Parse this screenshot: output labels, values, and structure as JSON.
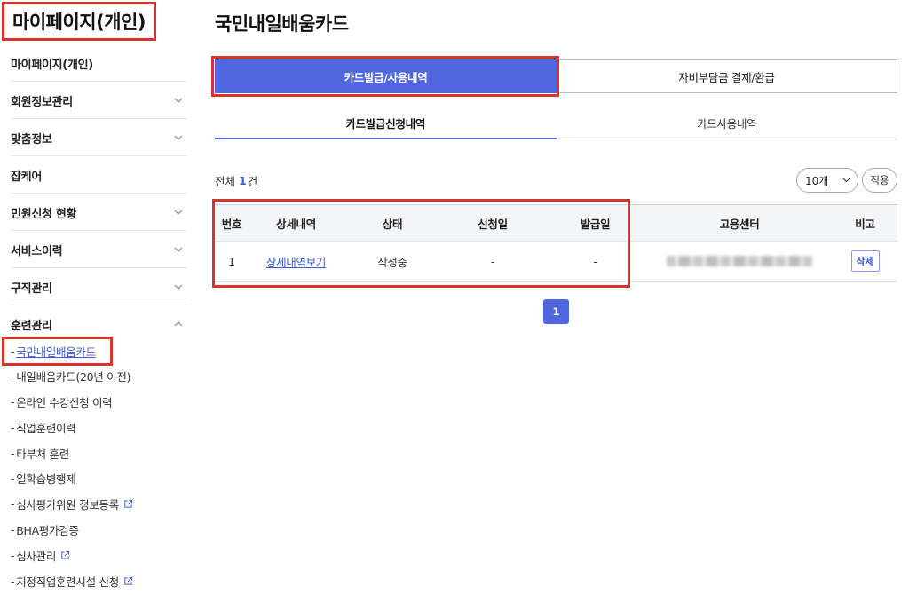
{
  "sidebar": {
    "title": "마이페이지(개인)",
    "menu": [
      {
        "label": "마이페이지(개인)"
      },
      {
        "label": "회원정보관리"
      },
      {
        "label": "맞춤정보"
      },
      {
        "label": "잡케어"
      },
      {
        "label": "민원신청 현황"
      },
      {
        "label": "서비스이력"
      },
      {
        "label": "구직관리"
      },
      {
        "label": "훈련관리"
      }
    ],
    "sub_items": [
      {
        "label": "국민내일배움카드"
      },
      {
        "label": "내일배움카드(20년 이전)"
      },
      {
        "label": "온라인 수강신청 이력"
      },
      {
        "label": "직업훈련이력"
      },
      {
        "label": "타부처 훈련"
      },
      {
        "label": "일학습병행제"
      },
      {
        "label": "심사평가위원 정보등록"
      },
      {
        "label": "BHA평가검증"
      },
      {
        "label": "심사관리"
      },
      {
        "label": "지정직업훈련시설 신청"
      }
    ],
    "dash": "-"
  },
  "main": {
    "title": "국민내일배움카드",
    "tabs": [
      {
        "label": "카드발급/사용내역"
      },
      {
        "label": "자비부담금 결제/환급"
      }
    ],
    "subtabs": [
      {
        "label": "카드발급신청내역"
      },
      {
        "label": "카드사용내역"
      }
    ],
    "total": {
      "prefix": "전체",
      "count": "1",
      "suffix": "건"
    },
    "page_size": {
      "selected": "10개"
    },
    "apply_label": "적용",
    "table": {
      "headers": [
        "번호",
        "상세내역",
        "상태",
        "신청일",
        "발급일",
        "고용센터",
        "비고"
      ],
      "rows": [
        {
          "no": "1",
          "detail": "상세내역보기",
          "status": "작성중",
          "applied": "-",
          "issued": "-",
          "center": "",
          "action": "삭제"
        }
      ]
    },
    "pagination": {
      "current": "1"
    }
  },
  "colors": {
    "accent": "#4f66e0",
    "link": "#3b5bdb",
    "highlight": "#d9342b"
  }
}
